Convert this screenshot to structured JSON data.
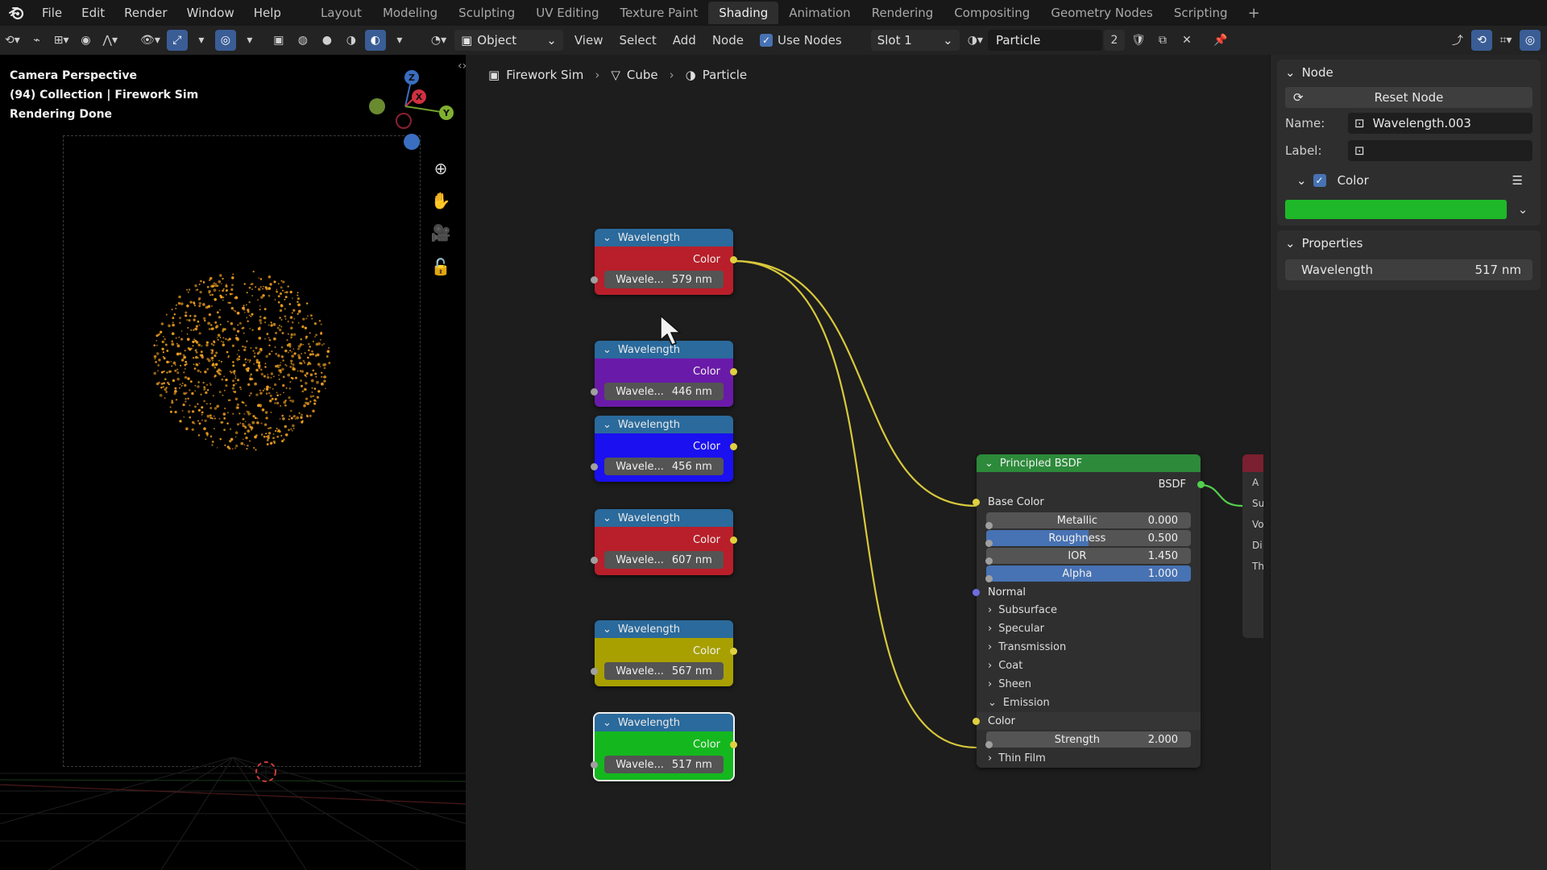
{
  "menubar": {
    "menus": [
      "File",
      "Edit",
      "Render",
      "Window",
      "Help"
    ],
    "workspaces": [
      "Layout",
      "Modeling",
      "Sculpting",
      "UV Editing",
      "Texture Paint",
      "Shading",
      "Animation",
      "Rendering",
      "Compositing",
      "Geometry Nodes",
      "Scripting"
    ],
    "active_workspace": "Shading",
    "add_label": "+"
  },
  "toolbar": {
    "mode": "Object",
    "menus": [
      "View",
      "Select",
      "Add",
      "Node"
    ],
    "use_nodes_label": "Use Nodes",
    "slot": "Slot 1",
    "material_name": "Particle",
    "user_count": "2"
  },
  "viewport": {
    "line1": "Camera Perspective",
    "line2": "(94) Collection | Firework Sim",
    "line3": "Rendering Done",
    "gizmo": {
      "z": "Z",
      "x": "X",
      "y": "Y"
    },
    "particle_color": "#f0a020"
  },
  "breadcrumb": {
    "scene": "Firework Sim",
    "object": "Cube",
    "material": "Particle"
  },
  "wavelength_nodes": [
    {
      "title": "Wavelength",
      "output": "Color",
      "field_label": "Wavele...",
      "value": "579 nm",
      "color": "#b81f2a"
    },
    {
      "title": "Wavelength",
      "output": "Color",
      "field_label": "Wavele...",
      "value": "446 nm",
      "color": "#6a1aa8"
    },
    {
      "title": "Wavelength",
      "output": "Color",
      "field_label": "Wavele...",
      "value": "456 nm",
      "color": "#1a10f0"
    },
    {
      "title": "Wavelength",
      "output": "Color",
      "field_label": "Wavele...",
      "value": "607 nm",
      "color": "#b81f2a"
    },
    {
      "title": "Wavelength",
      "output": "Color",
      "field_label": "Wavele...",
      "value": "567 nm",
      "color": "#a8a000"
    },
    {
      "title": "Wavelength",
      "output": "Color",
      "field_label": "Wavele...",
      "value": "517 nm",
      "color": "#14b81e"
    }
  ],
  "bsdf": {
    "title": "Principled BSDF",
    "output": "BSDF",
    "base_color": "Base Color",
    "metallic": {
      "label": "Metallic",
      "value": "0.000"
    },
    "roughness": {
      "label": "Roughness",
      "value": "0.500",
      "fill": 0.5
    },
    "ior": {
      "label": "IOR",
      "value": "1.450"
    },
    "alpha": {
      "label": "Alpha",
      "value": "1.000"
    },
    "normal": "Normal",
    "sections": [
      "Subsurface",
      "Specular",
      "Transmission",
      "Coat",
      "Sheen"
    ],
    "emission": "Emission",
    "emission_color": "Color",
    "strength": {
      "label": "Strength",
      "value": "2.000"
    },
    "thin_film": "Thin Film"
  },
  "output_node": {
    "labels": [
      "A",
      "Su",
      "Vo",
      "Di",
      "Th"
    ]
  },
  "sidebar": {
    "node_panel_title": "Node",
    "reset_label": "Reset Node",
    "name_label": "Name:",
    "name_value": "Wavelength.003",
    "label_label": "Label:",
    "label_value": "",
    "color_label": "Color",
    "node_color": "#1fb82a",
    "properties_title": "Properties",
    "wavelength_label": "Wavelength",
    "wavelength_value": "517 nm"
  }
}
